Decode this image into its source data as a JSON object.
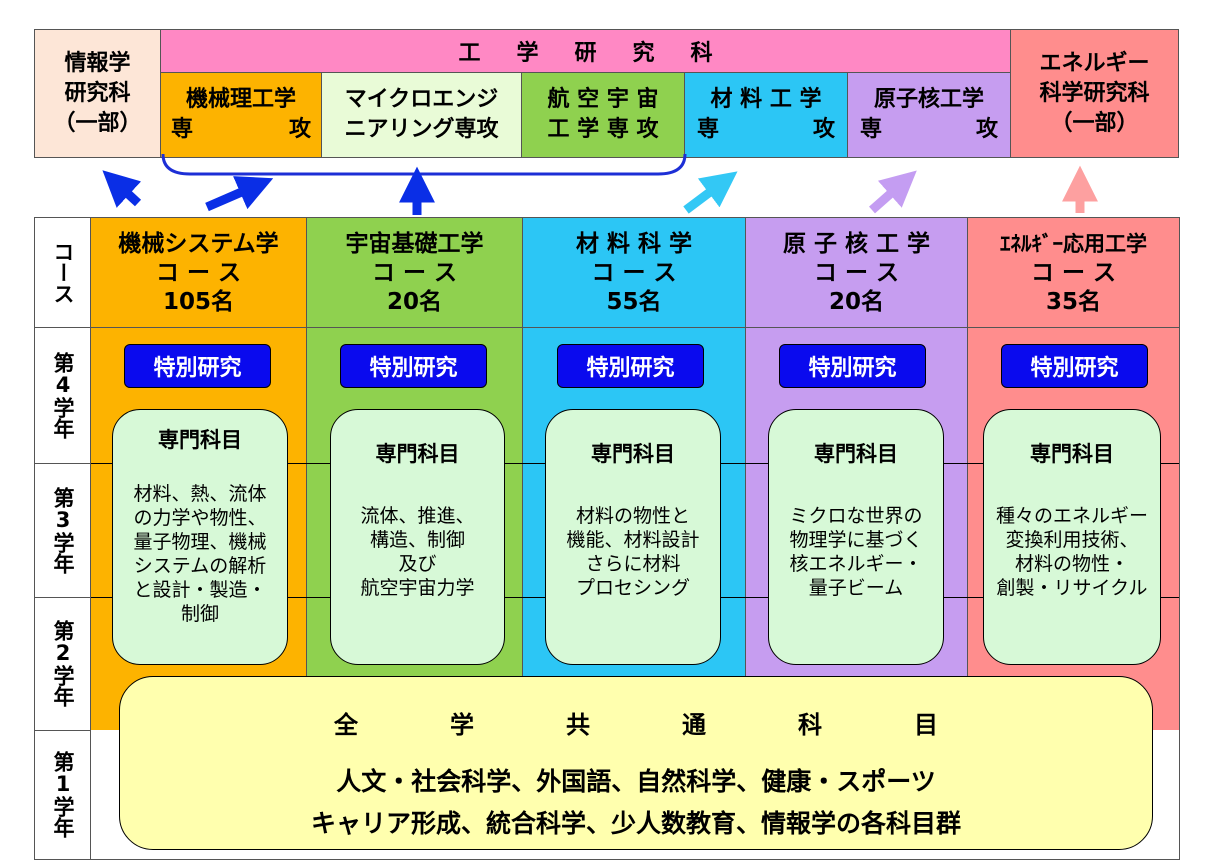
{
  "colors": {
    "info": "#fde6d7",
    "engineering": "#ff88c4",
    "kikai": "#fdb300",
    "micro": "#e9fbd7",
    "koku": "#8fd14f",
    "zairyo": "#2cc6f5",
    "genshi": "#c69df0",
    "energy": "#ff8d8d",
    "subject": "#d7f9d7",
    "common": "#ffffae",
    "badge": "#0a0aee"
  },
  "top": {
    "info": {
      "line1": "情報学",
      "line2": "研究科",
      "line3": "（一部）"
    },
    "engineering_title": [
      "工",
      "学",
      "研",
      "究",
      "科"
    ],
    "energy": {
      "line1": "エネルギー",
      "line2": "科学研究科",
      "line3": "（一部）"
    },
    "majors": [
      {
        "line1": "機械理工学",
        "line2a": "専",
        "line2b": "攻"
      },
      {
        "line1": "マイクロエンジ",
        "line2": "ニアリング専攻"
      },
      {
        "line1": "航 空 宇 宙",
        "line2": "工 学 専 攻"
      },
      {
        "line1": "材 料 工 学",
        "line2a": "専",
        "line2b": "攻"
      },
      {
        "line1": "原子核工学",
        "line2a": "専",
        "line2b": "攻"
      }
    ]
  },
  "course_label": "コース",
  "courses": [
    {
      "name": "機械システム学",
      "sub": "コ ー ス",
      "count": "105名"
    },
    {
      "name": "宇宙基礎工学",
      "sub": "コ ー ス",
      "count": "20名"
    },
    {
      "name": "材 料 科 学",
      "sub": "コ ー ス",
      "count": "55名"
    },
    {
      "name": "原 子 核 工 学",
      "sub": "コ ー ス",
      "count": "20名"
    },
    {
      "name": "ｴﾈﾙｷﾞｰ応用工学",
      "sub": "コ ー ス",
      "count": "35名"
    }
  ],
  "years": [
    "第4学年",
    "第3学年",
    "第2学年",
    "第1学年"
  ],
  "special_research": "特別研究",
  "subject_title": "専門科目",
  "subjects": [
    "材料、熱、流体\nの力学や物性、\n量子物理、機械\nシステムの解析\nと設計・製造・\n制御",
    "流体、推進、\n構造、制御\n及び\n航空宇宙力学",
    "材料の物性と\n機能、材料設計\nさらに材料\nプロセシング",
    "ミクロな世界の\n物理学に基づく\n核エネルギー・\n量子ビーム",
    "種々のエネルギー\n変換利用技術、\n材料の物性・\n創製・リサイクル"
  ],
  "common": {
    "title": [
      "全",
      "学",
      "共",
      "通",
      "科",
      "目"
    ],
    "line1": "人文・社会科学、外国語、自然科学、健康・スポーツ",
    "line2": "キャリア形成、統合科学、少人数教育、情報学の各科目群"
  }
}
